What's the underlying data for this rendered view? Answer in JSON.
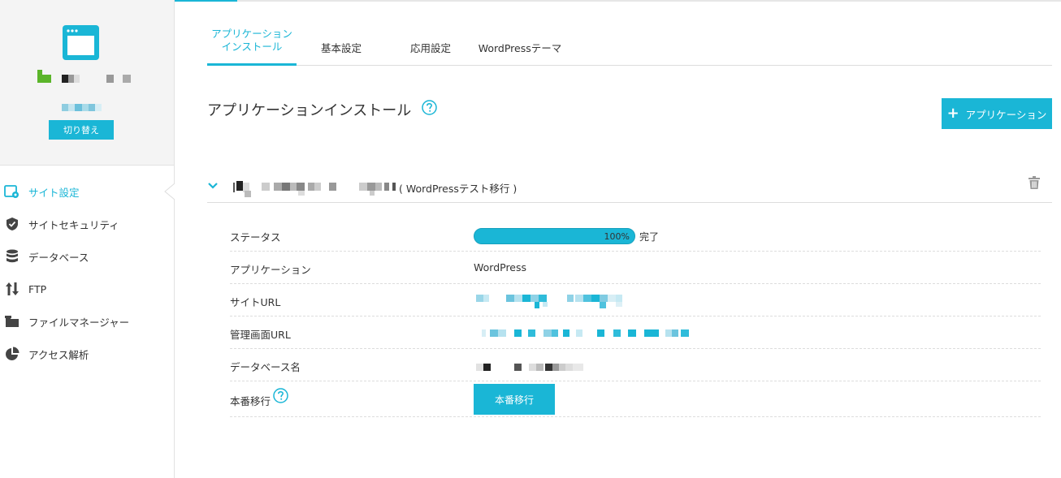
{
  "colors": {
    "accent": "#1ab6d6",
    "text": "#333333",
    "border": "#dddddd",
    "sidebar_bg": "#f4f4f4"
  },
  "sidebar": {
    "site_icon": "browser-window-icon",
    "switch_label": "切り替え",
    "items": [
      {
        "label": "サイト設定",
        "icon": "site-settings-icon",
        "active": true
      },
      {
        "label": "サイトセキュリティ",
        "icon": "shield-icon",
        "active": false
      },
      {
        "label": "データベース",
        "icon": "database-icon",
        "active": false
      },
      {
        "label": "FTP",
        "icon": "ftp-arrows-icon",
        "active": false
      },
      {
        "label": "ファイルマネージャー",
        "icon": "folder-icon",
        "active": false
      },
      {
        "label": "アクセス解析",
        "icon": "pie-chart-icon",
        "active": false
      }
    ]
  },
  "tabs": [
    {
      "label": "アプリケーション\nインストール",
      "active": true
    },
    {
      "label": "基本設定",
      "active": false
    },
    {
      "label": "応用設定",
      "active": false
    },
    {
      "label": "WordPressテーマ",
      "active": false
    }
  ],
  "main": {
    "title": "アプリケーションインストール",
    "add_button_label": "アプリケーション",
    "install": {
      "name_suffix": "( WordPressテスト移行 )",
      "rows": {
        "status_label": "ステータス",
        "progress_percent": 100,
        "progress_text": "100%",
        "status_text": "完了",
        "application_label": "アプリケーション",
        "application_value": "WordPress",
        "site_url_label": "サイトURL",
        "admin_url_label": "管理画面URL",
        "db_name_label": "データベース名",
        "production_label": "本番移行",
        "production_button": "本番移行"
      }
    }
  }
}
